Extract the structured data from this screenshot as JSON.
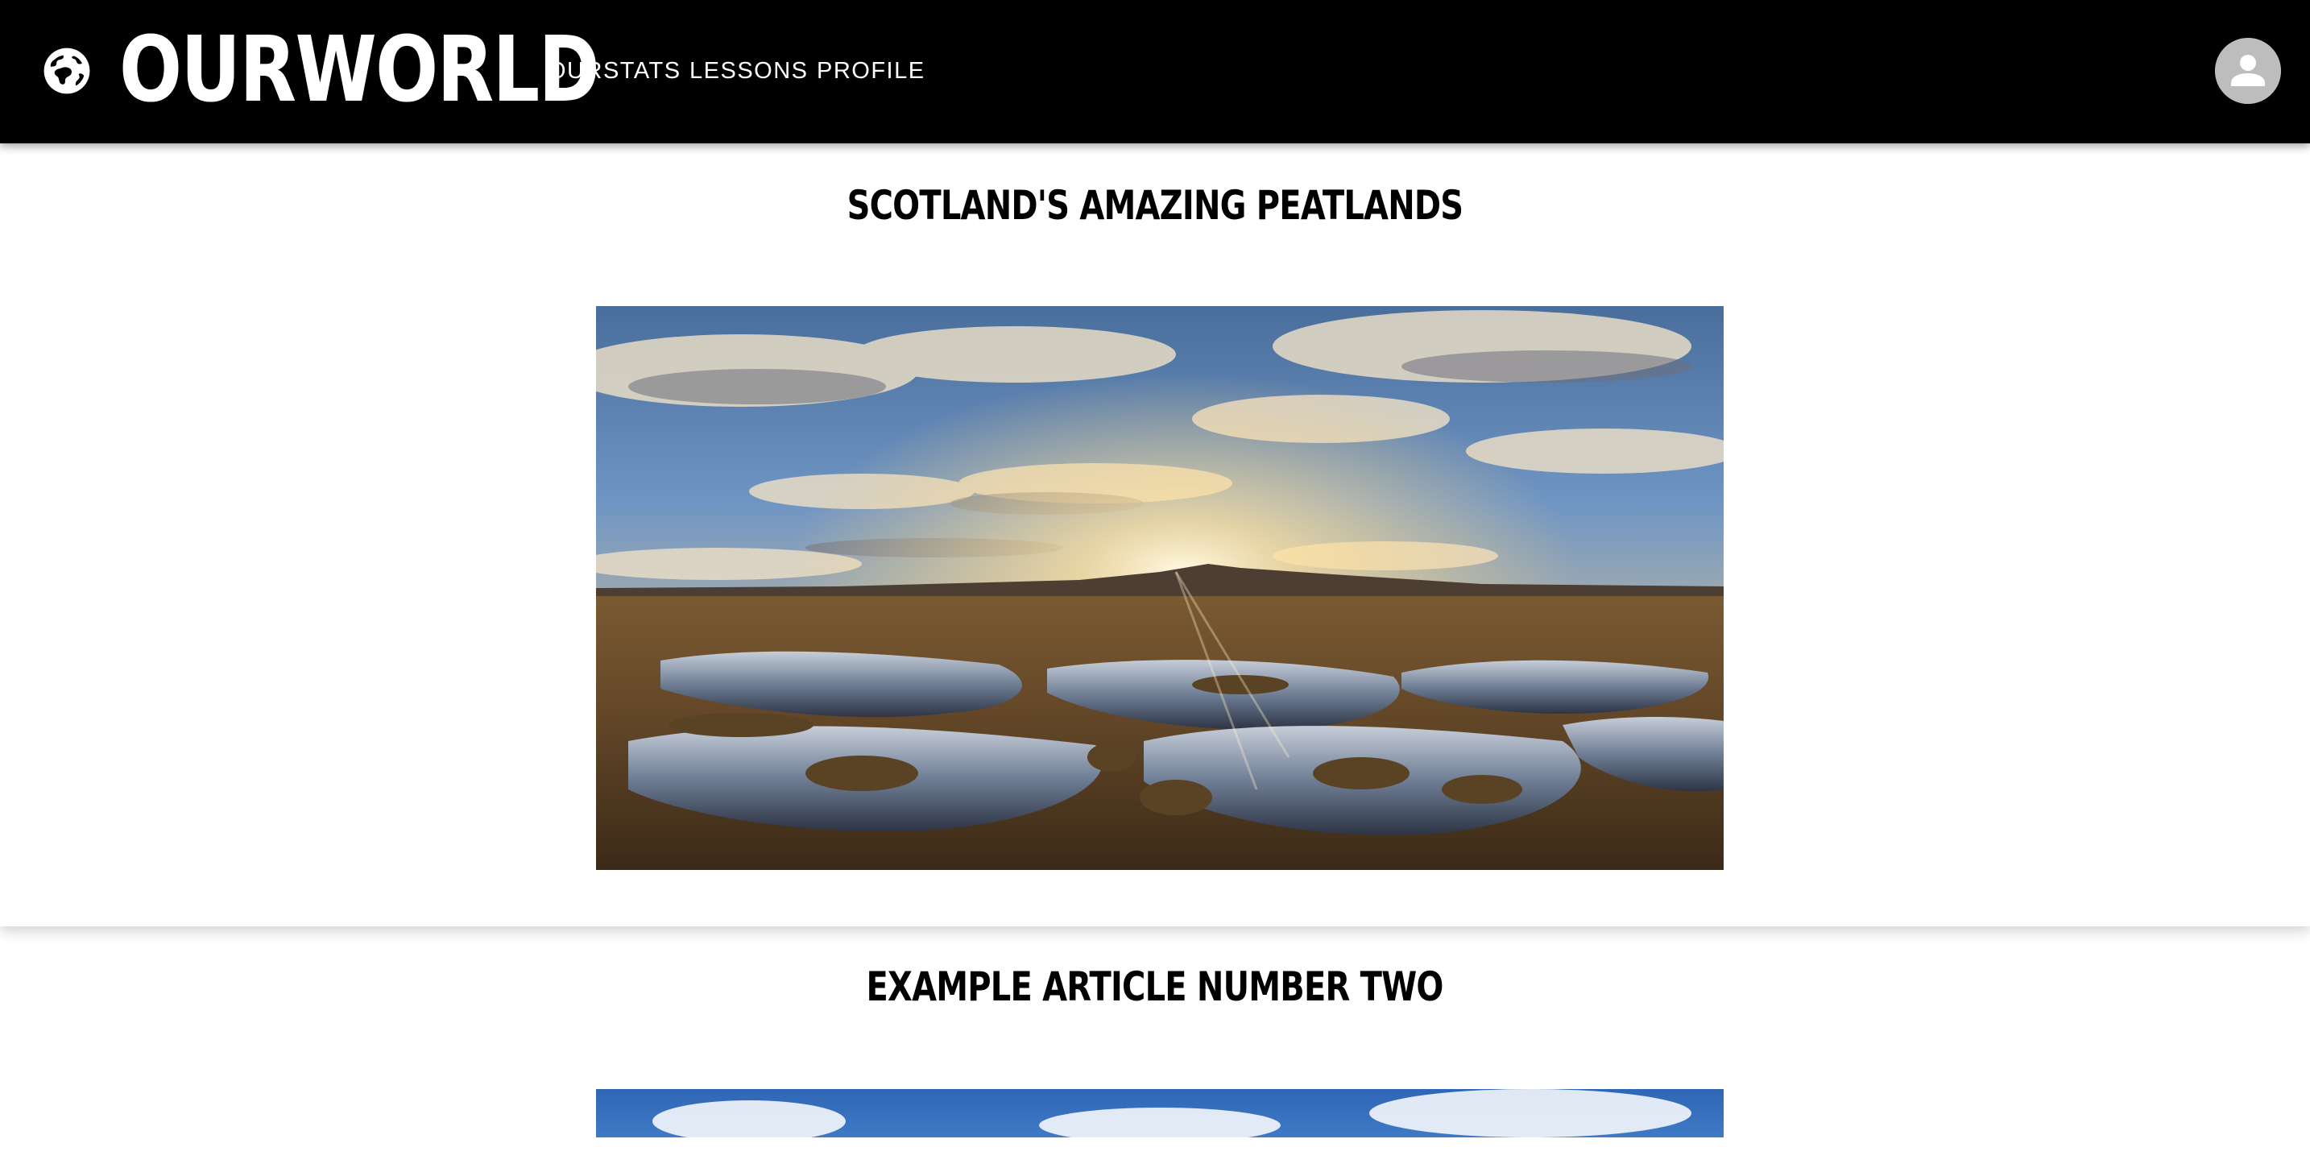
{
  "app": {
    "brand": "OURWORLD",
    "logo_icon": "globe-icon",
    "nav": [
      {
        "label": "OURSTATS"
      },
      {
        "label": "LESSONS"
      },
      {
        "label": "PROFILE"
      }
    ],
    "account_icon": "account-circle-icon"
  },
  "articles": [
    {
      "title": "SCOTLAND'S AMAZING PEATLANDS",
      "image": "peatland-sunset-landscape"
    },
    {
      "title": "EXAMPLE ARTICLE NUMBER TWO",
      "image": "blue-sky-landscape"
    }
  ],
  "colors": {
    "appbar": "#000000",
    "text_light": "#ffffff",
    "text_dark": "#000000",
    "avatar": "#bdbdbd"
  }
}
